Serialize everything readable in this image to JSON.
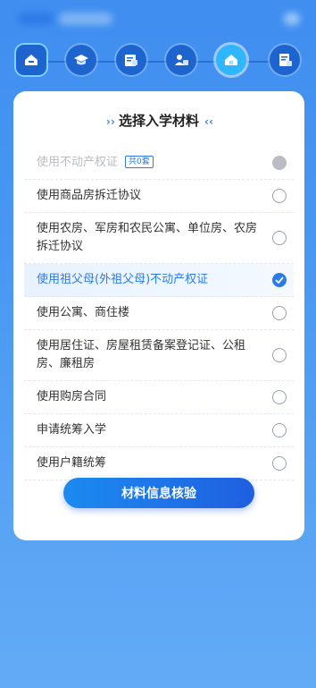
{
  "colors": {
    "accent": "#2c7be5",
    "background": "#4a98f2",
    "disabled": "#b9bcc2"
  },
  "stepper": {
    "steps": [
      {
        "icon": "home-icon"
      },
      {
        "icon": "graduation-cap-icon"
      },
      {
        "icon": "id-card-icon"
      },
      {
        "icon": "parents-icon"
      },
      {
        "icon": "house-material-icon",
        "active": true
      },
      {
        "icon": "review-document-icon"
      }
    ]
  },
  "card": {
    "title": "选择入学材料",
    "items": [
      {
        "label": "使用不动产权证",
        "tag": "共0套",
        "state": "disabled"
      },
      {
        "label": "使用商品房拆迁协议",
        "state": "unchecked"
      },
      {
        "label": "使用农房、军房和农民公寓、单位房、农房拆迁协议",
        "state": "unchecked"
      },
      {
        "label": "使用祖父母(外祖父母)不动产权证",
        "state": "checked"
      },
      {
        "label": "使用公寓、商住楼",
        "state": "unchecked"
      },
      {
        "label": "使用居住证、房屋租赁备案登记证、公租房、廉租房",
        "state": "unchecked"
      },
      {
        "label": "使用购房合同",
        "state": "unchecked"
      },
      {
        "label": "申请统筹入学",
        "state": "unchecked"
      },
      {
        "label": "使用户籍统筹",
        "state": "unchecked"
      }
    ],
    "button_label": "材料信息核验"
  }
}
